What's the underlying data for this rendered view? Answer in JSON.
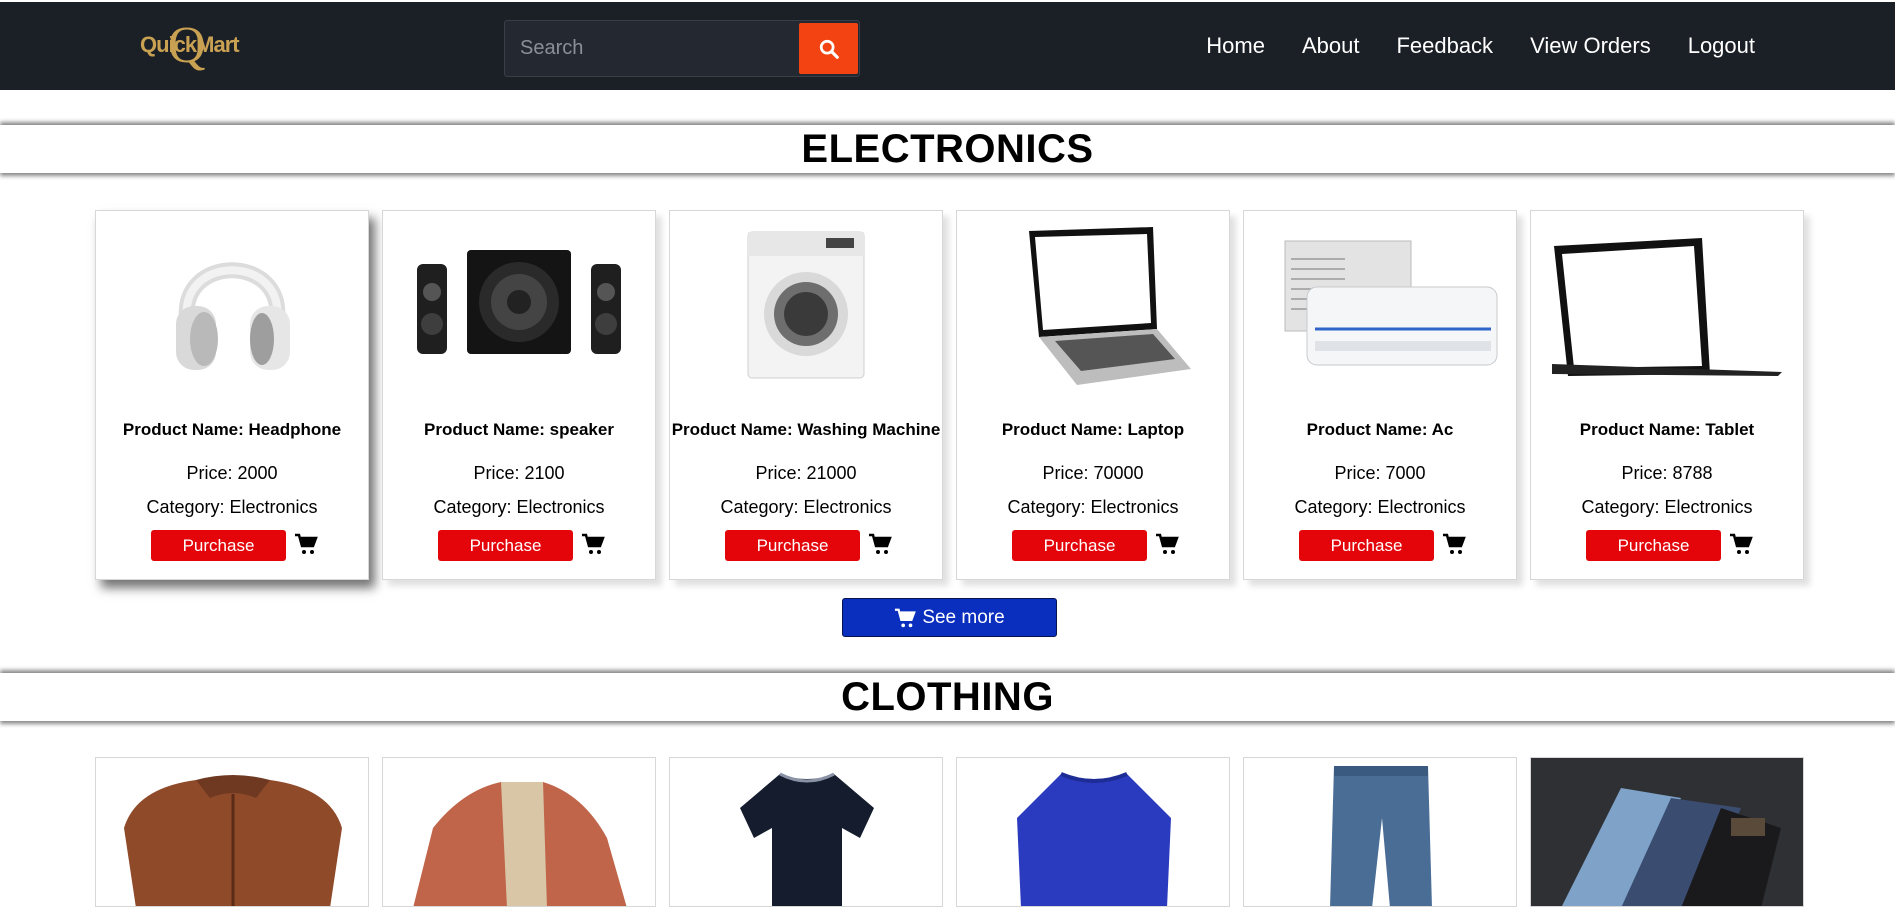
{
  "brand": {
    "logo_text": "QuickMart",
    "logo_letter": "Q",
    "accent": "#c9a152"
  },
  "search": {
    "placeholder": "Search",
    "button_color": "#f34313"
  },
  "nav": {
    "links": [
      "Home",
      "About",
      "Feedback",
      "View Orders",
      "Logout"
    ]
  },
  "sections": [
    {
      "title": "ELECTRONICS",
      "products": [
        {
          "name": "Product Name: Headphone",
          "price": "Price: 2000",
          "category": "Category: Electronics",
          "image": "headphone"
        },
        {
          "name": "Product Name: speaker",
          "price": "Price: 2100",
          "category": "Category: Electronics",
          "image": "speaker"
        },
        {
          "name": "Product Name: Washing Machine",
          "price": "Price: 21000",
          "category": "Category: Electronics",
          "image": "washing-machine"
        },
        {
          "name": "Product Name: Laptop",
          "price": "Price: 70000",
          "category": "Category: Electronics",
          "image": "laptop"
        },
        {
          "name": "Product Name: Ac",
          "price": "Price: 7000",
          "category": "Category: Electronics",
          "image": "ac"
        },
        {
          "name": "Product Name: Tablet",
          "price": "Price: 8788",
          "category": "Category: Electronics",
          "image": "tablet"
        }
      ],
      "purchase_label": "Purchase",
      "see_more_label": "See more"
    },
    {
      "title": "CLOTHING",
      "products": [
        {
          "image": "leather-jacket"
        },
        {
          "image": "bomber-jacket"
        },
        {
          "image": "navy-tshirt"
        },
        {
          "image": "blue-sweatshirt"
        },
        {
          "image": "blue-jeans"
        },
        {
          "image": "stacked-jeans"
        }
      ]
    }
  ],
  "colors": {
    "purchase": "#e3050a",
    "see_more": "#0a2fbf",
    "navbar": "#1b1f26"
  }
}
